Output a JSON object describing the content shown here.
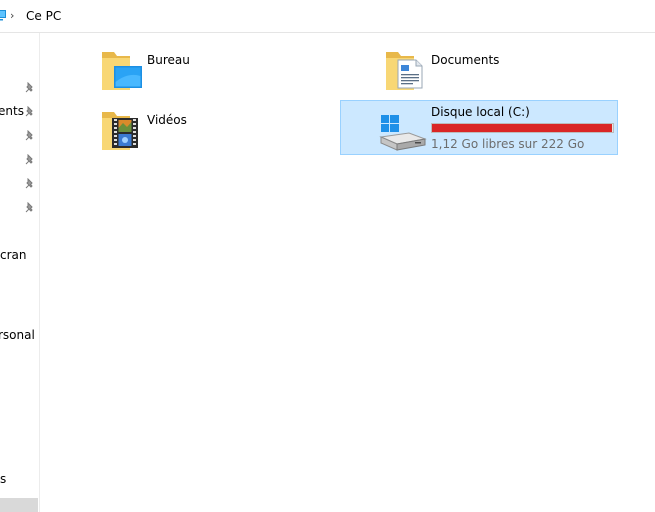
{
  "addressbar": {
    "separator": "›",
    "location": "Ce PC"
  },
  "navigation": {
    "items": [
      {
        "label": "ents",
        "pinned": true
      },
      {
        "label": "cran",
        "pinned": false
      },
      {
        "label": "rsonal",
        "pinned": false
      },
      {
        "label": "s",
        "pinned": false
      }
    ]
  },
  "folders": [
    {
      "label": "Bureau",
      "icon": "desktop-folder-icon"
    },
    {
      "label": "Documents",
      "icon": "documents-folder-icon"
    },
    {
      "label": "Vidéos",
      "icon": "videos-folder-icon"
    }
  ],
  "drive": {
    "title": "Disque local (C:)",
    "subtitle": "1,12 Go libres sur 222 Go",
    "used_fraction": 0.995,
    "bar_color": "#da2626",
    "icon": "windows-drive-icon"
  },
  "colors": {
    "selection_bg": "#cce8ff",
    "selection_border": "#99d1ff",
    "folder_yellow": "#f8d775"
  }
}
